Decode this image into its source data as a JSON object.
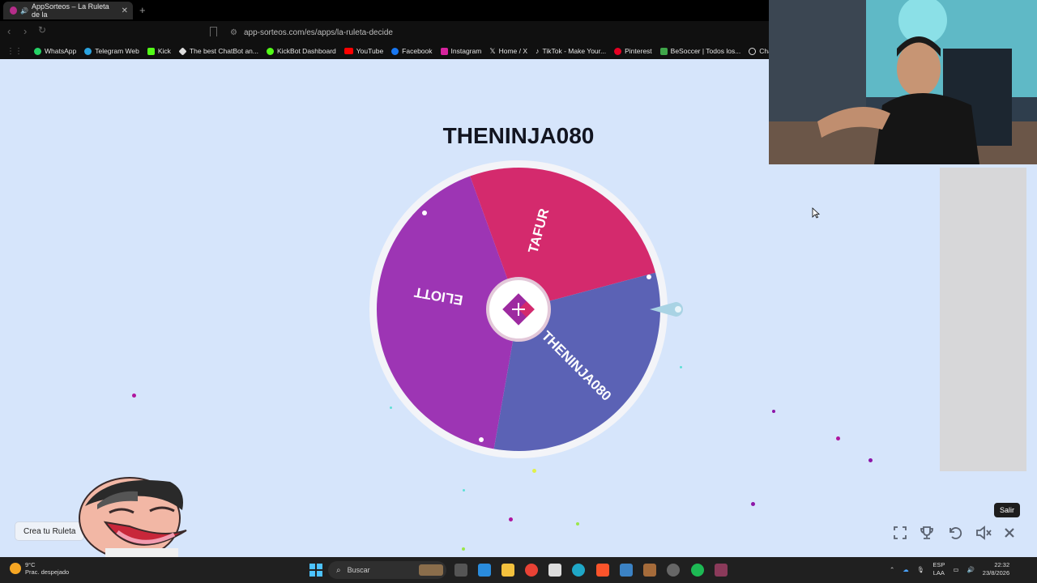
{
  "browser": {
    "tab_title": "AppSorteos – La Ruleta de la",
    "url": "app-sorteos.com/es/apps/la-ruleta-decide",
    "bookmarks": [
      "WhatsApp",
      "Telegram Web",
      "Kick",
      "The best ChatBot an...",
      "KickBot Dashboard",
      "YouTube",
      "Facebook",
      "Instagram",
      "Home / X",
      "TikTok - Make Your...",
      "Pinterest",
      "BeSoccer | Todos los...",
      "ChatGPT"
    ]
  },
  "page": {
    "winner_title": "THENINJA080",
    "wheel": {
      "segments": [
        {
          "label": "TAFUR",
          "color": "#d42a6d"
        },
        {
          "label": "THENINJA080",
          "color": "#5b62b5"
        },
        {
          "label": "ELIOTT",
          "color": "#9d35b4"
        }
      ],
      "pointer_color": "#a9d3e4"
    },
    "create_button": "Crea tu Ruleta",
    "tooltip": "Salir",
    "controls": [
      "fullscreen-icon",
      "trophy-icon",
      "reset-icon",
      "sound-icon",
      "close-icon"
    ]
  },
  "taskbar": {
    "weather_temp": "9°C",
    "weather_desc": "Prac. despejado",
    "search_placeholder": "Buscar",
    "lang_top": "ESP",
    "lang_bottom": "LAA",
    "time": "22:32",
    "date": "23/8/2026"
  }
}
